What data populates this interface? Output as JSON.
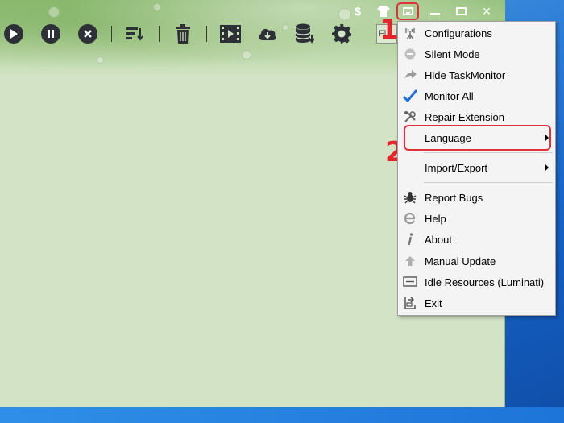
{
  "toolbar": {
    "buttons": [
      {
        "name": "start",
        "icon": "play-icon"
      },
      {
        "name": "pause",
        "icon": "pause-icon"
      },
      {
        "name": "cancel",
        "icon": "cancel-icon"
      },
      {
        "name": "sort",
        "icon": "sort-icon"
      },
      {
        "name": "delete",
        "icon": "trash-icon"
      },
      {
        "name": "video",
        "icon": "film-icon"
      },
      {
        "name": "cloud-download",
        "icon": "cloud-download-icon"
      },
      {
        "name": "database",
        "icon": "database-icon"
      },
      {
        "name": "settings",
        "icon": "gear-icon"
      }
    ],
    "search_text": "Fi"
  },
  "title_controls": {
    "dollar": "$",
    "menu_icon": "menu-box-icon",
    "minimize_icon": "minimize-icon",
    "maximize_icon": "maximize-icon",
    "close": "✕"
  },
  "annotations": {
    "step1": "1",
    "step2": "2",
    "color": "#e3262e"
  },
  "menu": {
    "items": [
      {
        "label": "Configurations",
        "icon": "antenna-icon"
      },
      {
        "label": "Silent Mode",
        "icon": "minus-circle-icon"
      },
      {
        "label": "Hide TaskMonitor",
        "icon": "arrow-icon"
      },
      {
        "label": "Monitor All",
        "icon": "checkmark-icon"
      },
      {
        "label": "Repair Extension",
        "icon": "tools-icon"
      },
      {
        "label": "Language",
        "icon": "",
        "submenu": true
      },
      {
        "label": "Import/Export",
        "icon": "",
        "submenu": true
      },
      {
        "label": "Report Bugs",
        "icon": "bug-icon"
      },
      {
        "label": "Help",
        "icon": "help-e-icon"
      },
      {
        "label": "About",
        "icon": "info-icon"
      },
      {
        "label": "Manual Update",
        "icon": "up-arrow-icon"
      },
      {
        "label": "Idle Resources (Luminati)",
        "icon": "monitor-icon"
      },
      {
        "label": "Exit",
        "icon": "exit-icon"
      }
    ]
  },
  "colors": {
    "app_background": "#d3e4c6",
    "menu_background": "#f4f4f4",
    "highlight": "#e0303a",
    "check_blue": "#1e6fd9"
  }
}
